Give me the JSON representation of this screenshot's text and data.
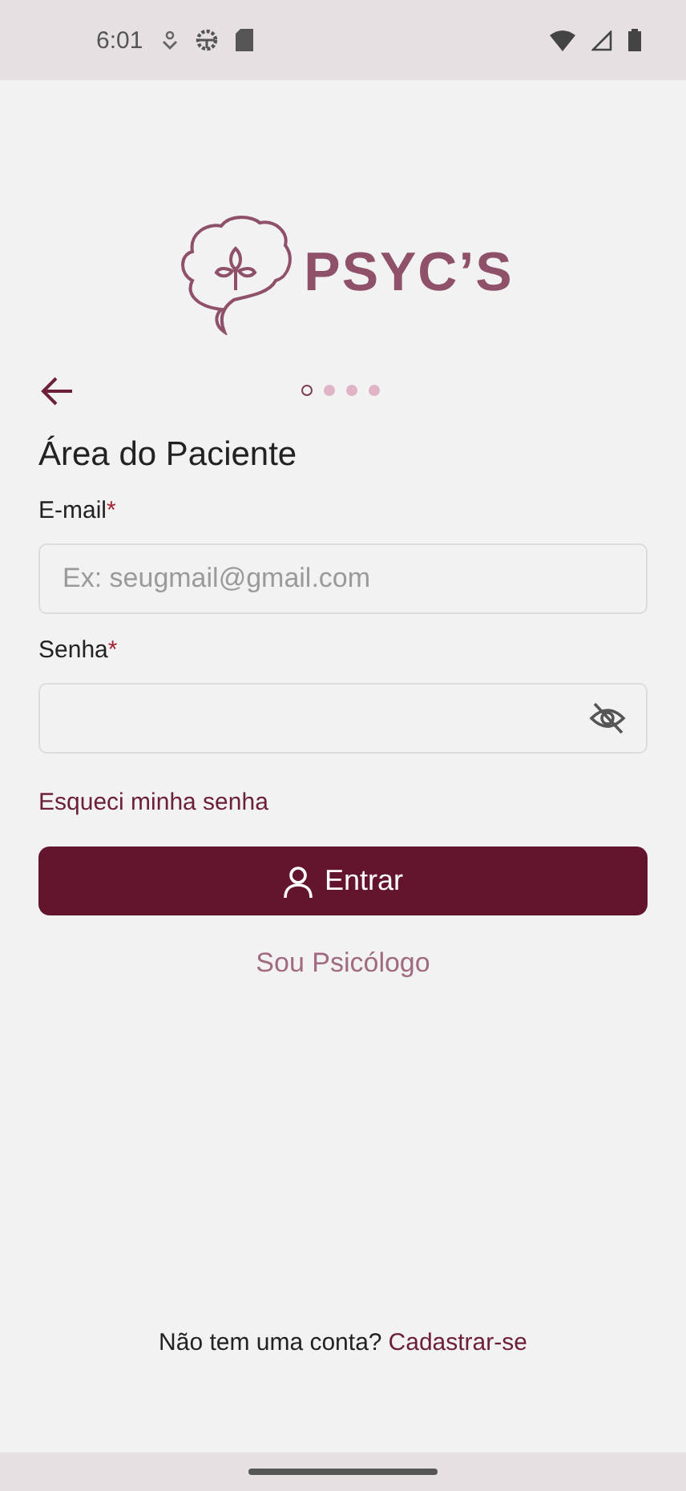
{
  "status_bar": {
    "time": "6:01"
  },
  "logo": {
    "name": "PSYC’S"
  },
  "pager": [
    {
      "selected": true
    },
    {
      "selected": false
    },
    {
      "selected": false
    },
    {
      "selected": false
    }
  ],
  "title": "Área do Paciente",
  "fields": [
    {
      "kind": "text",
      "label": "E-mail",
      "required": "*",
      "placeholder": "Ex: seugmail@gmail.com"
    },
    {
      "kind": "password",
      "label": "Senha",
      "required": "*",
      "password_visible": false
    }
  ],
  "forgot_link": "Esqueci minha senha",
  "login_button": "Entrar",
  "psychologist_link": "Sou Psicólogo",
  "signup": {
    "prompt": "Não tem uma conta?",
    "link": "Cadastrar-se"
  }
}
